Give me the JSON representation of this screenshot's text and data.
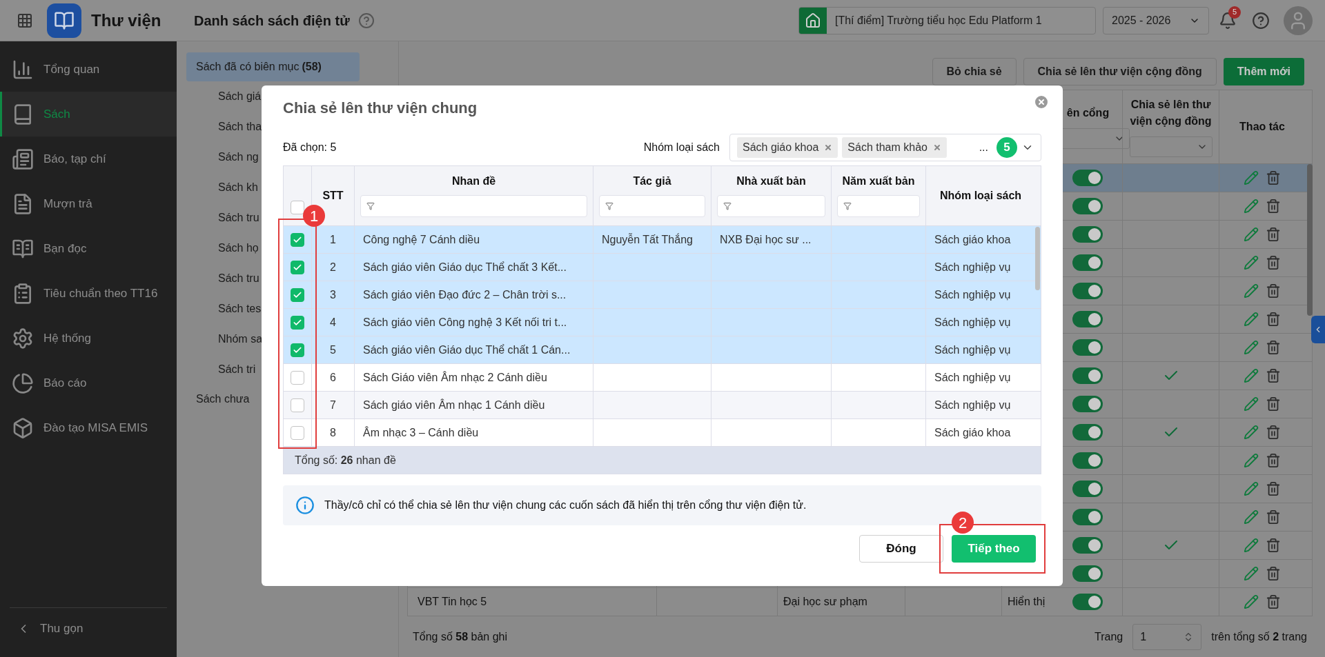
{
  "app": {
    "title": "Thư viện"
  },
  "page_title": "Danh sách sách điện tử",
  "school": "[Thí điểm] Trường tiểu học Edu Platform 1",
  "year": "2025 - 2026",
  "notification_count": "5",
  "sidebar": {
    "items": [
      {
        "label": "Tổng quan",
        "selected": false
      },
      {
        "label": "Sách",
        "selected": true
      },
      {
        "label": "Báo, tạp chí",
        "selected": false
      },
      {
        "label": "Mượn trả",
        "selected": false
      },
      {
        "label": "Bạn đọc",
        "selected": false
      },
      {
        "label": "Tiêu chuẩn theo TT16",
        "selected": false
      },
      {
        "label": "Hệ thống",
        "selected": false
      },
      {
        "label": "Báo cáo",
        "selected": false
      },
      {
        "label": "Đào tạo MISA EMIS",
        "selected": false
      }
    ],
    "collapse": "Thu gọn"
  },
  "subnav": {
    "items": [
      {
        "label": "Sách đã có biên mục",
        "count": "(58)",
        "selected": true,
        "children": [
          {
            "label": "Sách giá"
          },
          {
            "label": "Sách tha"
          },
          {
            "label": "Sách ng"
          },
          {
            "label": "Sách kh"
          },
          {
            "label": "Sách tru"
          },
          {
            "label": "Sách họ"
          },
          {
            "label": "Sách tru"
          },
          {
            "label": "Sách tes"
          },
          {
            "label": "Nhóm sa"
          },
          {
            "label": "Sách tri"
          }
        ]
      },
      {
        "label": "Sách chưa",
        "selected": false
      }
    ]
  },
  "toolbar_buttons": [
    {
      "label": "Bỏ chia sẻ",
      "kind": "outline"
    },
    {
      "label": "Chia sẻ lên thư viện cộng đồng",
      "kind": "outline"
    },
    {
      "label": "Thêm mới",
      "kind": "primary"
    }
  ],
  "main_table": {
    "columns": [
      "ên cổng",
      "Chia sẻ lên thư viện cộng đồng",
      "Thao tác"
    ],
    "rows": [
      {
        "on": true,
        "shared": false,
        "selected": true
      },
      {
        "on": true,
        "shared": false,
        "selected": false
      },
      {
        "on": true,
        "shared": false,
        "selected": false
      },
      {
        "on": true,
        "shared": false,
        "selected": false
      },
      {
        "on": true,
        "shared": false,
        "selected": false
      },
      {
        "on": true,
        "shared": false,
        "selected": false
      },
      {
        "on": true,
        "shared": false,
        "selected": false
      },
      {
        "on": true,
        "shared": true,
        "selected": false
      },
      {
        "on": true,
        "shared": false,
        "selected": false
      },
      {
        "on": true,
        "shared": true,
        "selected": false
      },
      {
        "on": true,
        "shared": false,
        "selected": false
      },
      {
        "on": true,
        "shared": false,
        "selected": false
      },
      {
        "on": true,
        "shared": false,
        "selected": false
      },
      {
        "on": true,
        "shared": true,
        "selected": false
      },
      {
        "on": true,
        "shared": false,
        "selected": false
      },
      {
        "on": true,
        "shared": false,
        "selected": false,
        "title": "VBT Tin học 5",
        "publisher": "Đại học sư phạm",
        "status": "Hiển thị"
      }
    ],
    "total_prefix": "Tổng số",
    "total": "58",
    "total_suffix": "bản ghi",
    "page_label": "Trang",
    "page": "1",
    "pages_prefix": "trên tổng số",
    "pages": "2",
    "pages_suffix": "trang"
  },
  "modal": {
    "title": "Chia sẻ lên thư viện chung",
    "selected_count": "Đã chọn: 5",
    "filter_label": "Nhóm loại sách",
    "filter_tags": [
      "Sách giáo khoa",
      "Sách tham khảo"
    ],
    "filter_more": "...",
    "filter_count": "5",
    "table": {
      "all_selected": false,
      "columns": [
        {
          "label": "STT",
          "filter": false
        },
        {
          "label": "Nhan đề",
          "filter": true
        },
        {
          "label": "Tác giả",
          "filter": true
        },
        {
          "label": "Nhà xuất bản",
          "filter": true
        },
        {
          "label": "Năm xuất bản",
          "filter": true
        },
        {
          "label": "Nhóm loại sách",
          "filter": false
        }
      ],
      "rows": [
        {
          "selected": true,
          "cells": [
            "1",
            "Công nghệ 7 Cánh diều",
            "Nguyễn Tất Thắng",
            "NXB Đại học sư ...",
            "",
            "Sách giáo khoa"
          ]
        },
        {
          "selected": true,
          "cells": [
            "2",
            "Sách giáo viên Giáo dục Thể chất 3 Kết...",
            "",
            "",
            "",
            "Sách nghiệp vụ"
          ]
        },
        {
          "selected": true,
          "cells": [
            "3",
            "Sách giáo viên Đạo đức 2 – Chân trời s...",
            "",
            "",
            "",
            "Sách nghiệp vụ"
          ]
        },
        {
          "selected": true,
          "cells": [
            "4",
            "Sách giáo viên Công nghệ 3 Kết nối tri t...",
            "",
            "",
            "",
            "Sách nghiệp vụ"
          ]
        },
        {
          "selected": true,
          "cells": [
            "5",
            "Sách giáo viên Giáo dục Thể chất 1 Cán...",
            "",
            "",
            "",
            "Sách nghiệp vụ"
          ]
        },
        {
          "selected": false,
          "cells": [
            "6",
            "Sách Giáo viên Âm nhạc 2 Cánh diều",
            "",
            "",
            "",
            "Sách nghiệp vụ"
          ]
        },
        {
          "selected": false,
          "cells": [
            "7",
            "Sách giáo viên Âm nhạc 1 Cánh diều",
            "",
            "",
            "",
            "Sách nghiệp vụ"
          ]
        },
        {
          "selected": false,
          "cells": [
            "8",
            "Âm nhạc 3 – Cánh diều",
            "",
            "",
            "",
            "Sách giáo khoa"
          ]
        }
      ],
      "footer": "Tổng số: **26** nhan đề"
    },
    "info": "Thầy/cô chỉ có thể chia sẻ lên thư viện chung các cuốn sách đã hiển thị trên cổng thư viện điện tử.",
    "buttons": [
      {
        "label": "Đóng",
        "kind": "secondary"
      },
      {
        "label": "Tiếp theo",
        "kind": "primary"
      }
    ]
  },
  "annotations": [
    {
      "number": "1"
    },
    {
      "number": "2"
    }
  ]
}
